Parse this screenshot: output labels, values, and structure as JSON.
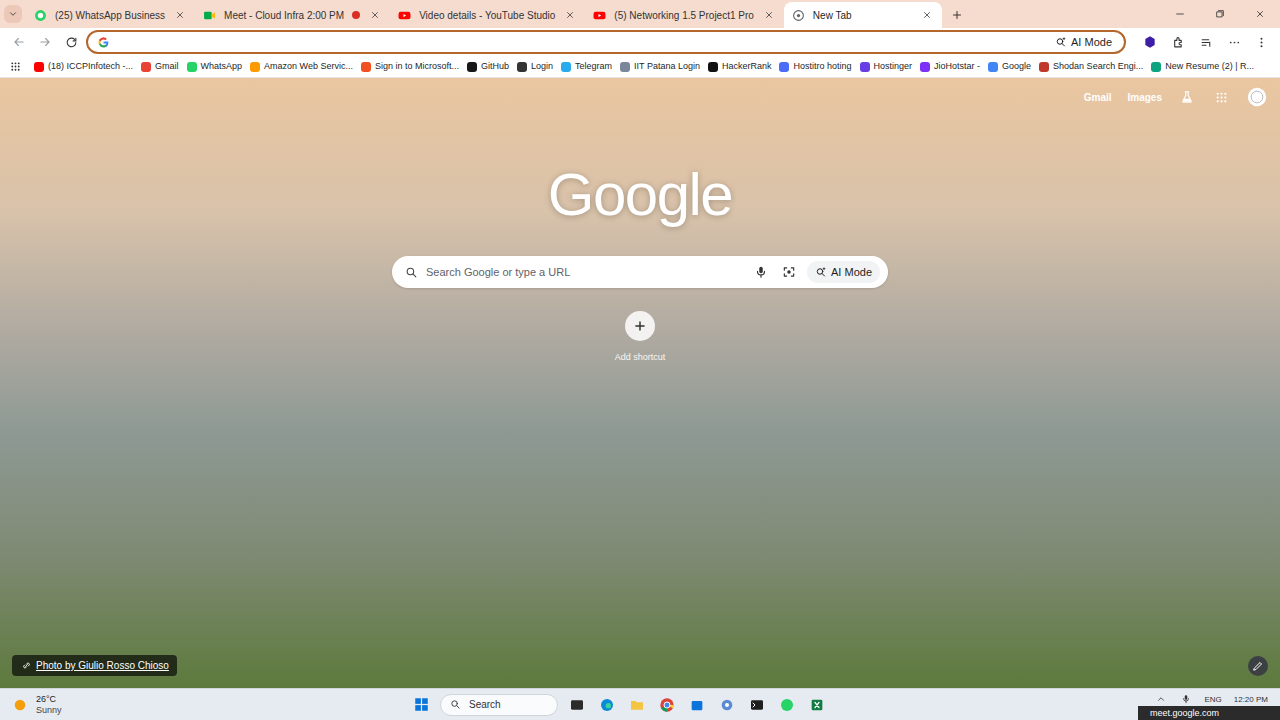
{
  "browser": {
    "tabs": [
      {
        "label": "(25) WhatsApp Business",
        "kind": "whatsapp",
        "selected": false,
        "recording": false
      },
      {
        "label": "Meet - Cloud Infra 2:00 PM",
        "kind": "meet",
        "selected": false,
        "recording": true
      },
      {
        "label": "Video details - YouTube Studio",
        "kind": "youtube",
        "selected": false,
        "recording": false
      },
      {
        "label": "(5) Networking 1.5 Project1 Pro",
        "kind": "youtube",
        "selected": false,
        "recording": false
      },
      {
        "label": "New Tab",
        "kind": "newtab",
        "selected": true,
        "recording": false
      }
    ],
    "address_bar": {
      "ai_mode": "AI Mode"
    },
    "bookmarks": [
      {
        "label": "(18) ICCPInfotech -...",
        "color": "#ff0000"
      },
      {
        "label": "Gmail",
        "color": "#ea4335"
      },
      {
        "label": "WhatsApp",
        "color": "#25d366"
      },
      {
        "label": "Amazon Web Servic...",
        "color": "#ff9900"
      },
      {
        "label": "Sign in to Microsoft...",
        "color": "#f25022"
      },
      {
        "label": "GitHub",
        "color": "#181717"
      },
      {
        "label": "Login",
        "color": "#333333"
      },
      {
        "label": "Telegram",
        "color": "#2aabee"
      },
      {
        "label": "IIT Patana Login",
        "color": "#7a869a"
      },
      {
        "label": "HackerRank",
        "color": "#111111"
      },
      {
        "label": "Hostitro hoting",
        "color": "#4a6cf7"
      },
      {
        "label": "Hostinger",
        "color": "#673de6"
      },
      {
        "label": "JioHotstar -",
        "color": "#7b2ff7"
      },
      {
        "label": "Google",
        "color": "#4285f4"
      },
      {
        "label": "Shodan Search Engi...",
        "color": "#c0392b"
      },
      {
        "label": "New Resume (2) | R...",
        "color": "#10a37f"
      }
    ]
  },
  "page": {
    "top_links": [
      "Gmail",
      "Images"
    ],
    "logo": "Google",
    "search": {
      "placeholder": "Search Google or type a URL",
      "ai_mode": "AI Mode"
    },
    "shortcut": {
      "label": "Add shortcut"
    },
    "photo_credit": "Photo by Giulio Rosso Chioso"
  },
  "taskbar": {
    "weather": {
      "temperature": "26°C",
      "condition": "Sunny"
    },
    "search": "Search",
    "language": "ENG",
    "time": "12:20 PM",
    "tooltip": "meet.google.com"
  }
}
